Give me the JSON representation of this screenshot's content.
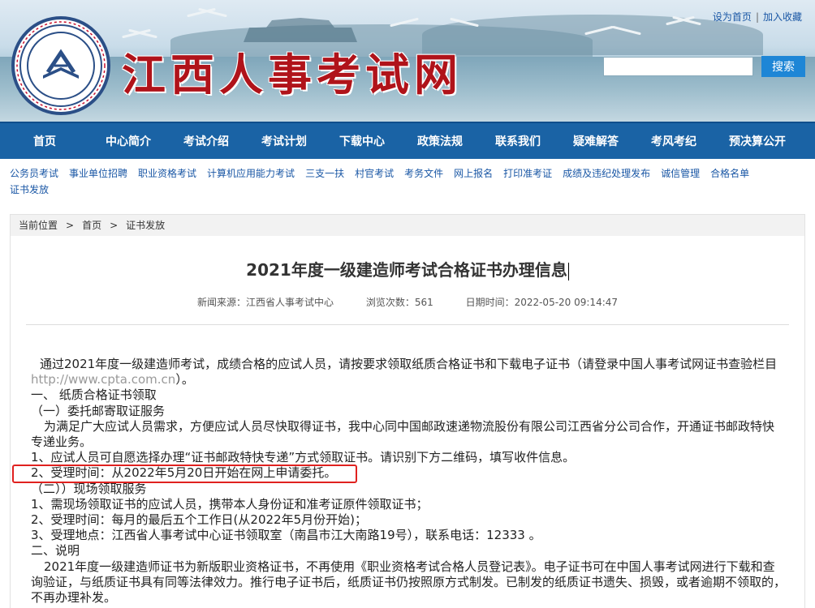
{
  "header": {
    "site_title": "江西人事考试网",
    "set_home": "设为首页",
    "separator": "|",
    "add_favorite": "加入收藏",
    "search_button": "搜索",
    "search_placeholder": ""
  },
  "nav": [
    "首页",
    "中心简介",
    "考试介绍",
    "考试计划",
    "下载中心",
    "政策法规",
    "联系我们",
    "疑难解答",
    "考风考纪",
    "预决算公开"
  ],
  "sublinks": [
    "公务员考试",
    "事业单位招聘",
    "职业资格考试",
    "计算机应用能力考试",
    "三支一扶",
    "村官考试",
    "考务文件",
    "网上报名",
    "打印准考证",
    "成绩及违纪处理发布",
    "诚信管理",
    "合格名单",
    "证书发放"
  ],
  "breadcrumb": {
    "label": "当前位置",
    "gt": ">",
    "home": "首页",
    "current": "证书发放"
  },
  "article": {
    "title": "2021年度一级建造师考试合格证书办理信息",
    "source": "新闻来源：江西省人事考试中心",
    "views": "浏览次数：561",
    "date": "日期时间：2022-05-20 09:14:47",
    "p1": "通过2021年度一级建造师考试，成绩合格的应试人员，请按要求领取纸质合格证书和下载电子证书（请登录中国人事考试网证书查验栏目",
    "p1_url": "http://www.cpta.com.cn",
    "p1_end": "）。",
    "h1": "一、 纸质合格证书领取",
    "h1_1": "（一）委托邮寄取证服务",
    "p2": "为满足广大应试人员需求，方便应试人员尽快取得证书，我中心同中国邮政速递物流股份有限公司江西省分公司合作，开通证书邮政特快专递业务。",
    "p3": "1、应试人员可自愿选择办理“证书邮政特快专递”方式领取证书。请识别下方二维码，填写收件信息。",
    "p4": "2、受理时间：从2022年5月20日开始在网上申请委托。",
    "h1_2": "（二））现场领取服务",
    "p5": "1、需现场领取证书的应试人员，携带本人身份证和准考证原件领取证书；",
    "p6": "2、受理时间：每月的最后五个工作日(从2022年5月份开始)；",
    "p7": "3、受理地点：江西省人事考试中心证书领取室（南昌市江大南路19号），联系电话：12333 。",
    "h2": "二、说明",
    "p8": "2021年度一级建造师证书为新版职业资格证书，不再使用《职业资格考试合格人员登记表》。电子证书可在中国人事考试网进行下载和查询验证，与纸质证书具有同等法律效力。推行电子证书后，纸质证书仍按照原方式制发。已制发的纸质证书遗失、损毁，或者逾期不领取的，不再办理补发。"
  },
  "colors": {
    "nav_bg": "#1a63a5",
    "title_red": "#b0131a",
    "link_blue": "#1a57a5",
    "highlight_red": "#e0211f",
    "search_btn": "#1e86d6"
  }
}
